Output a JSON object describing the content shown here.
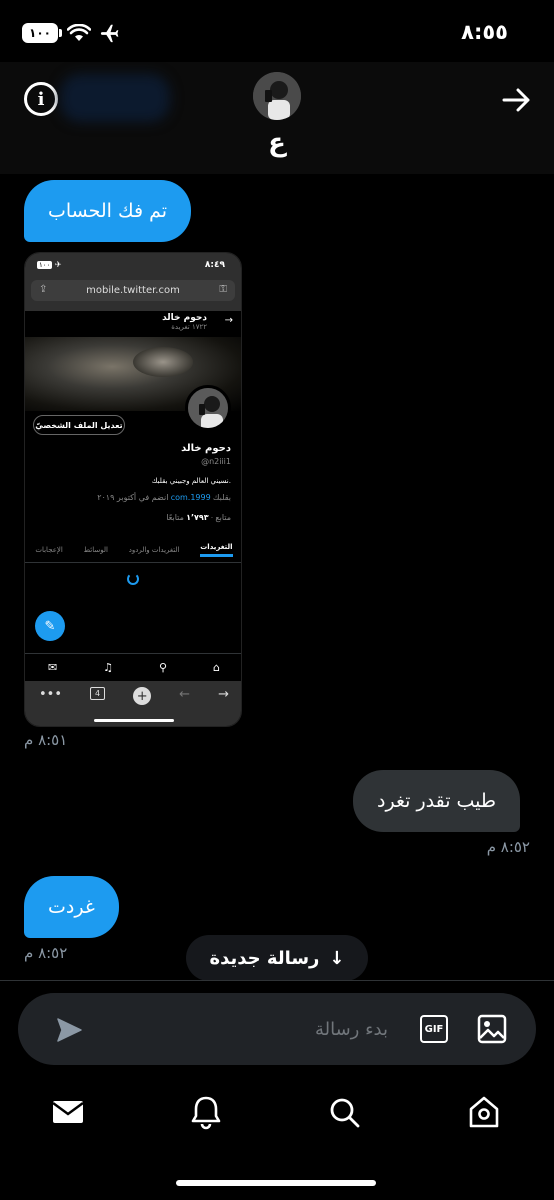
{
  "status_bar": {
    "time": "٨:٥٥",
    "battery": "١٠٠"
  },
  "header": {
    "contact_name": "ع"
  },
  "messages": [
    {
      "text": "تم فك الحساب",
      "direction": "incoming"
    },
    {
      "type": "image",
      "time": "٨:٥١ م"
    },
    {
      "text": "طيب تقدر تغرد",
      "direction": "outgoing",
      "time": "٨:٥٢ م"
    },
    {
      "text": "غردت",
      "direction": "incoming",
      "time": "٨:٥٢ م"
    }
  ],
  "screenshot": {
    "time": "٨:٤٩",
    "battery": "١٠٠",
    "url": "mobile.twitter.com",
    "profile_name": "دحوم خالد",
    "tweets_count": "١٧٢٢ تغريدة",
    "edit_profile": "تعديل الملف الشخصيّ",
    "display_name": "دحوم خالد",
    "handle": "@n2iii1",
    "bio": "نسيني العالم وجبيني بقلبك.",
    "location": "بقلبك",
    "link": "com.1999",
    "joined": "انضم في أكتوبر ٢٠١٩",
    "following_count": "١٬٧٩٣",
    "following_label": "متابعًا",
    "followers_label": "متابع",
    "tabs": [
      "التغريدات",
      "التغريدات والردود",
      "الوسائط",
      "الإعجابات"
    ],
    "tab_count": "4"
  },
  "new_message_pill": {
    "label": "رسالة جديدة",
    "arrow": "↓"
  },
  "composer": {
    "placeholder": "بدء رسالة",
    "gif_label": "GIF"
  },
  "colors": {
    "accent": "#1d9bf0",
    "bubble_out": "#2f3336",
    "background": "#000000",
    "muted": "#8b98a5"
  },
  "icons": [
    "airplane-icon",
    "wifi-icon",
    "battery-icon",
    "info-icon",
    "back-arrow-icon",
    "send-icon",
    "gif-icon",
    "image-icon",
    "messages-icon",
    "notifications-icon",
    "search-icon",
    "home-icon"
  ]
}
